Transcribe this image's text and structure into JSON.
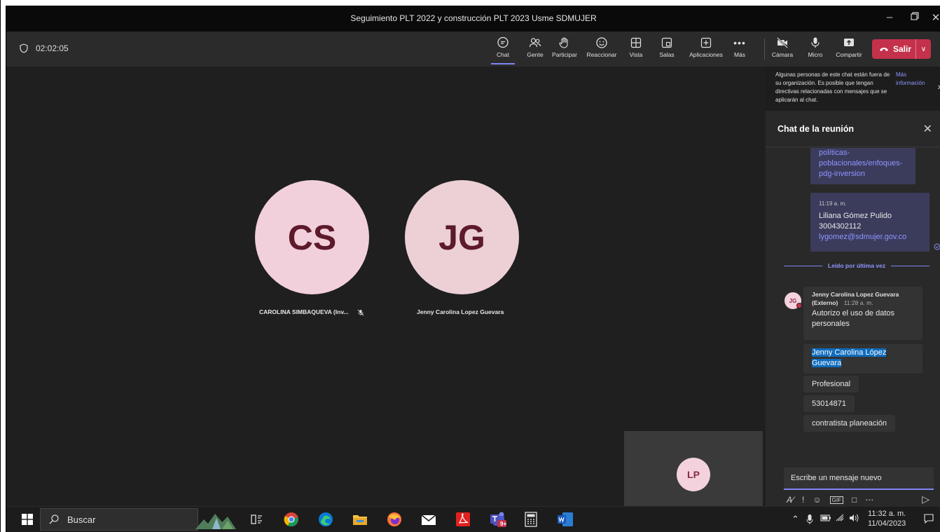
{
  "window": {
    "title": "Seguimiento PLT 2022 y construcción PLT 2023 Usme SDMUJER"
  },
  "meeting": {
    "timer": "02:02:05"
  },
  "toolbar": {
    "items": [
      {
        "label": "Chat",
        "icon": "chat-icon"
      },
      {
        "label": "Gente",
        "icon": "people-icon"
      },
      {
        "label": "Participar",
        "icon": "raise-hand-icon"
      },
      {
        "label": "Reaccionar",
        "icon": "smiley-icon"
      },
      {
        "label": "Vista",
        "icon": "grid-icon"
      },
      {
        "label": "Salas",
        "icon": "breakout-rooms-icon"
      },
      {
        "label": "Aplicaciones",
        "icon": "apps-plus-icon"
      },
      {
        "label": "Más",
        "icon": "more-icon"
      }
    ],
    "media": [
      {
        "label": "Cámara",
        "icon": "camera-off-icon"
      },
      {
        "label": "Micro",
        "icon": "mic-icon"
      },
      {
        "label": "Compartir",
        "icon": "share-icon"
      }
    ],
    "leave_label": "Salir",
    "colors": {
      "accent": "#7f85f5",
      "leave": "#c4314b"
    }
  },
  "stage": {
    "participants": [
      {
        "initials": "CS",
        "name": "CAROLINA SIMBAQUEVA (Inv...",
        "muted": true,
        "color": "#f1d0dc"
      },
      {
        "initials": "JG",
        "name": "Jenny Carolina Lopez Guevara",
        "muted": false,
        "color": "#ecd0d6"
      }
    ],
    "self_initials": "LP"
  },
  "chat": {
    "notice_text": "Algunas personas de este chat están fuera de su organización. Es posible que tengan directivas relacionadas con mensajes que se aplicarán al chat.",
    "notice_link": "Más información",
    "header": "Chat de la reunión",
    "msg1_lines": [
      "políticas-",
      "poblacionales/enfoques-",
      "pdg-inversion"
    ],
    "msg2": {
      "time": "11:19 a. m.",
      "lines": [
        "Liliana Gómez Pulido",
        "3004302112"
      ],
      "email": "lygomez@sdmujer.gov.co"
    },
    "read_label": "Leído por última vez",
    "other": {
      "initials": "JG",
      "sender_line1": "Jenny Carolina Lopez Guevara",
      "sender_line2": "(Externo)",
      "time": "11:28 a. m.",
      "messages": [
        "Autorizo el uso de datos personales",
        "Jenny Carolina López Guevara",
        "Profesional",
        "53014871",
        "contratista planeación"
      ]
    },
    "compose_placeholder": "Escribe un mensaje nuevo"
  },
  "taskbar": {
    "search_label": "Buscar",
    "teams_badge": "9+",
    "time": "11:32 a. m.",
    "date": "11/04/2023"
  }
}
